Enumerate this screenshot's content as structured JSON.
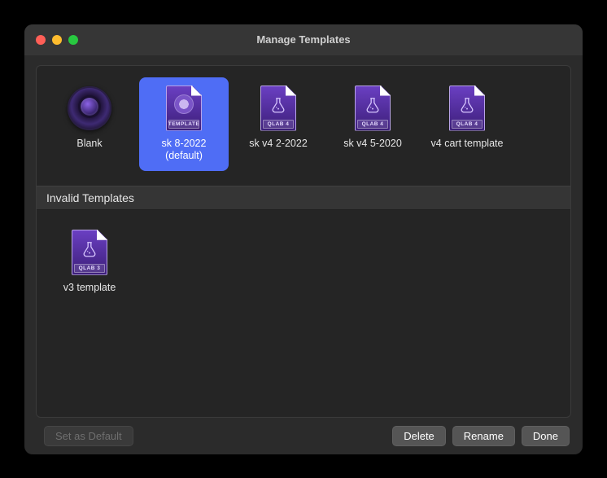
{
  "window": {
    "title": "Manage Templates"
  },
  "templates": [
    {
      "label": "Blank",
      "icon": "blank",
      "tag": "",
      "selected": false
    },
    {
      "label": "sk 8-2022 (default)",
      "icon": "template",
      "tag": "TEMPLATE",
      "selected": true
    },
    {
      "label": "sk v4 2-2022",
      "icon": "qlab",
      "tag": "QLAB 4",
      "selected": false
    },
    {
      "label": "sk v4 5-2020",
      "icon": "qlab",
      "tag": "QLAB 4",
      "selected": false
    },
    {
      "label": "v4 cart template",
      "icon": "qlab",
      "tag": "QLAB 4",
      "selected": false
    }
  ],
  "sections": {
    "invalid_header": "Invalid Templates"
  },
  "invalid_templates": [
    {
      "label": "v3 template",
      "icon": "qlab",
      "tag": "QLAB 3",
      "selected": false
    }
  ],
  "footer": {
    "set_default": "Set as Default",
    "set_default_enabled": false,
    "delete": "Delete",
    "rename": "Rename",
    "done": "Done"
  }
}
